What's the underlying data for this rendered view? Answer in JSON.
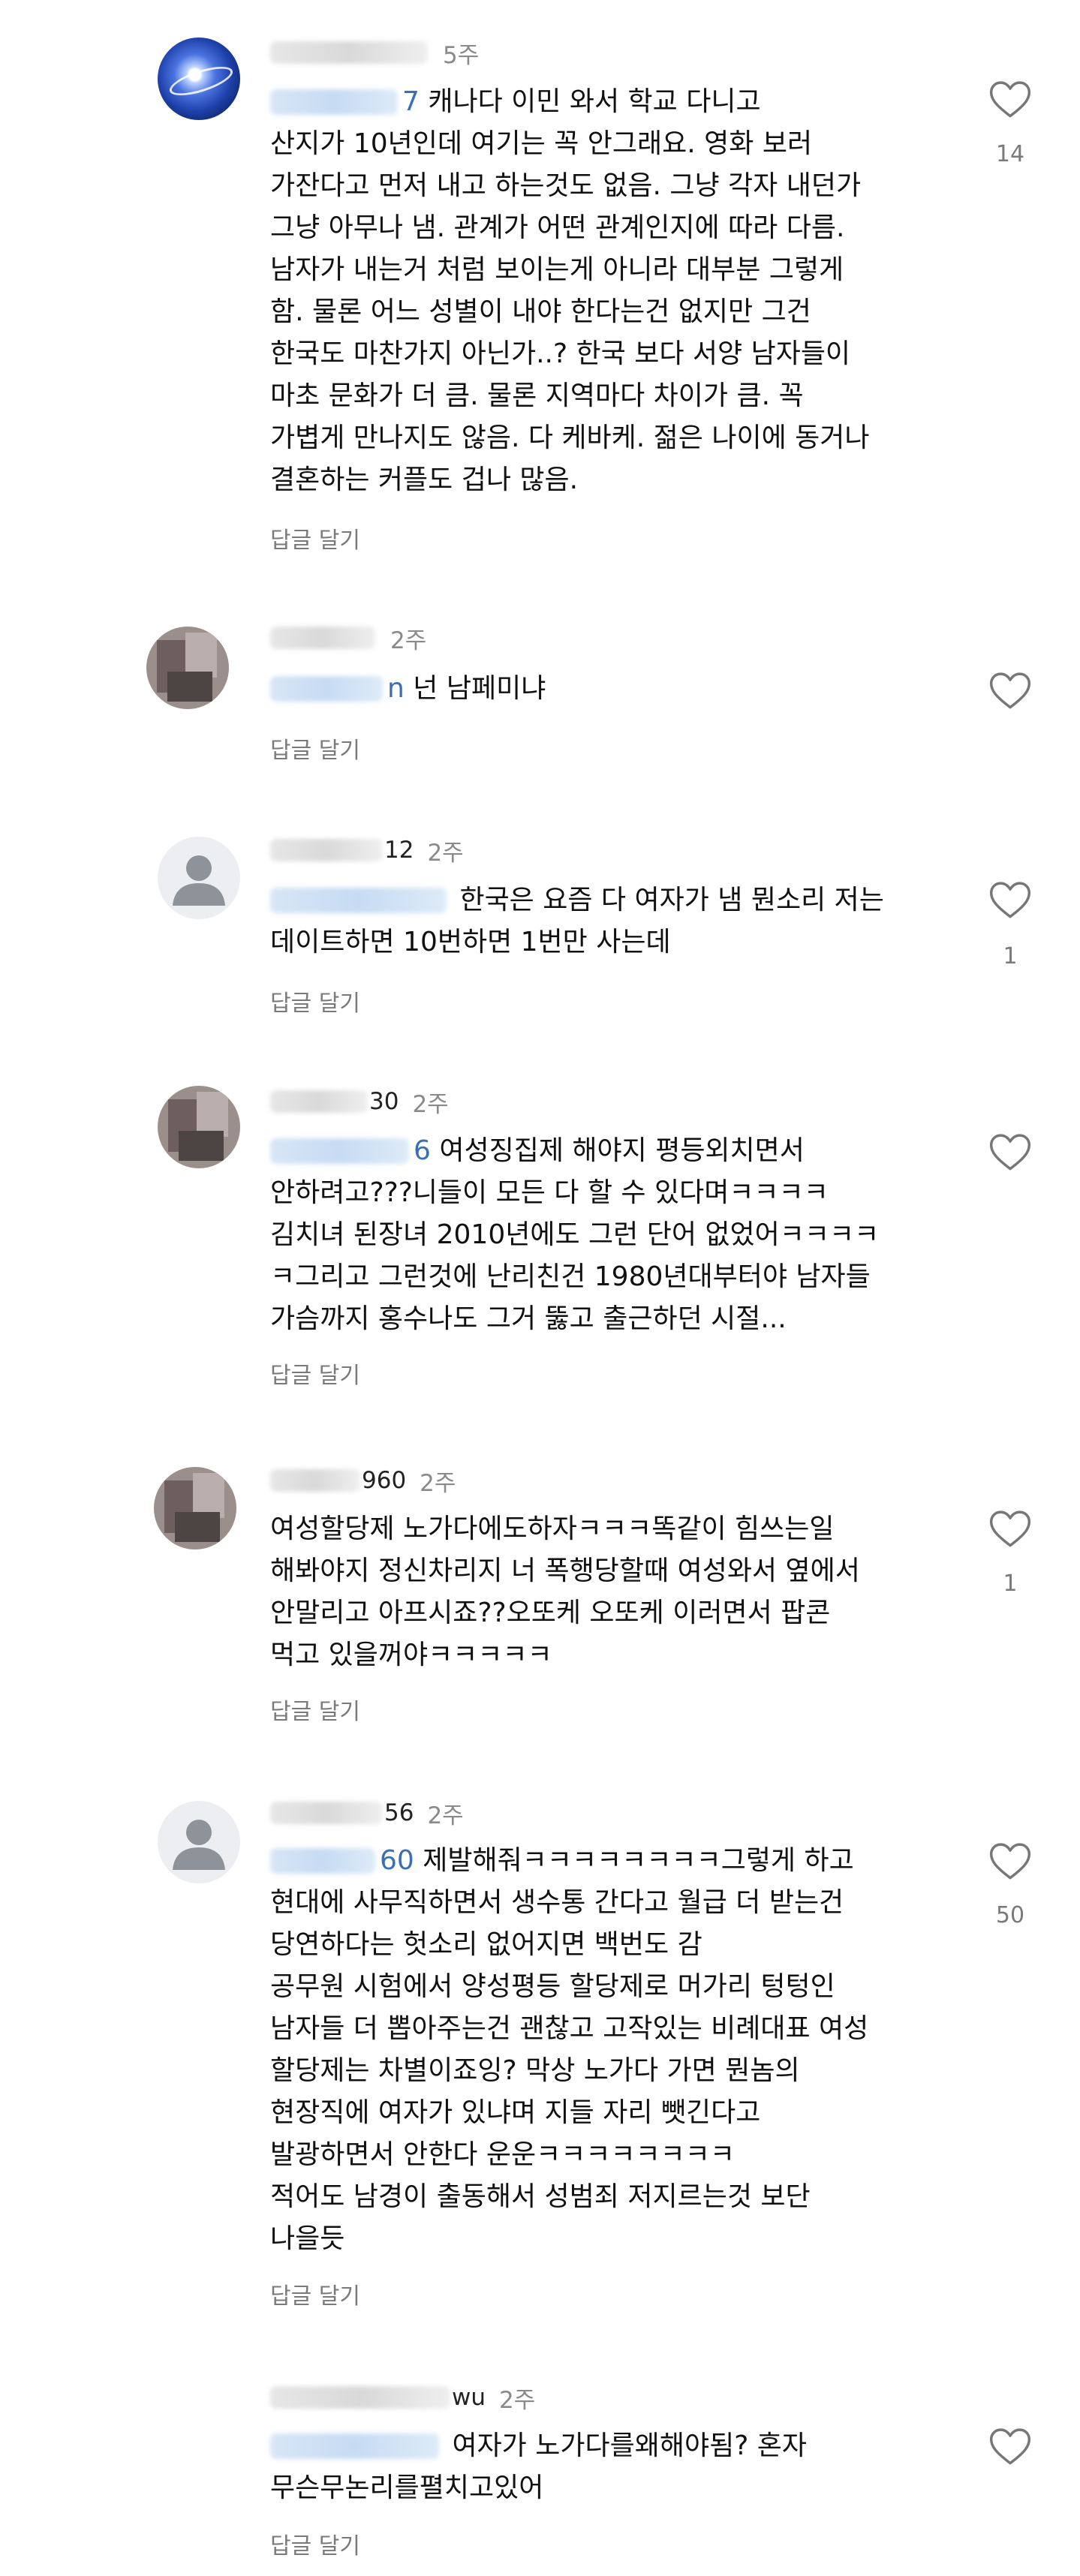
{
  "ui": {
    "reply_label": "답글 달기"
  },
  "comments": [
    {
      "name_tail": "",
      "time": "5주",
      "mention_tail": "7",
      "lines": [
        " 캐나다 이민 와서 학교 다니고",
        "산지가 10년인데 여기는 꼭 안그래요. 영화 보러",
        "가잔다고 먼저 내고 하는것도 없음. 그냥 각자 내던가",
        "그냥 아무나 냄. 관계가 어떤 관계인지에 따라 다름.",
        "남자가 내는거 처럼 보이는게 아니라 대부분 그렇게",
        "함. 물론 어느 성별이 내야 한다는건 없지만 그건",
        "한국도 마찬가지 아닌가..? 한국 보다 서양 남자들이",
        "마초 문화가 더 큼. 물론 지역마다 차이가 큼. 꼭",
        "가볍게 만나지도 않음. 다 케바케. 젊은 나이에 동거나",
        "결혼하는 커플도 겁나 많음."
      ],
      "likes": "14"
    },
    {
      "name_tail": "",
      "time": "2주",
      "mention_tail": "n",
      "lines": [
        " 넌 남페미냐"
      ],
      "likes": ""
    },
    {
      "name_tail": "12",
      "time": "2주",
      "mention_tail": "",
      "lines": [
        " 한국은 요즘 다 여자가 냄 뭔소리 저는",
        "데이트하면 10번하면 1번만 사는데"
      ],
      "likes": "1"
    },
    {
      "name_tail": "30",
      "time": "2주",
      "mention_tail": "6",
      "lines": [
        " 여성징집제 해야지 평등외치면서",
        "안하려고???니들이 모든 다 할 수 있다며ㅋㅋㅋㅋ",
        "김치녀 된장녀 2010년에도 그런 단어 없었어ㅋㅋㅋㅋ",
        "ㅋ그리고 그런것에 난리친건 1980년대부터야 남자들",
        "가슴까지 홍수나도 그거 뚫고 출근하던 시절..."
      ],
      "likes": ""
    },
    {
      "name_tail": "960",
      "time": "2주",
      "mention_tail": "",
      "lines": [
        "여성할당제 노가다에도하자ㅋㅋㅋ똑같이 힘쓰는일",
        "해봐야지 정신차리지 너 폭행당할때 여성와서 옆에서",
        "안말리고 아프시죠??오또케 오또케 이러면서 팝콘",
        "먹고 있을꺼야ㅋㅋㅋㅋㅋ"
      ],
      "likes": "1"
    },
    {
      "name_tail": "56",
      "time": "2주",
      "mention_tail": "60",
      "lines": [
        " 제발해줘ㅋㅋㅋㅋㅋㅋㅋㅋ그렇게 하고",
        "현대에 사무직하면서 생수통 간다고 월급 더 받는건",
        "당연하다는 헛소리 없어지면 백번도 감",
        "공무원 시험에서 양성평등 할당제로 머가리 텅텅인",
        "남자들 더 뽑아주는건 괜찮고 고작있는 비례대표 여성",
        "할당제는 차별이죠잉? 막상 노가다 가면 뭔놈의",
        "현장직에 여자가 있냐며 지들 자리 뺏긴다고",
        "발광하면서 안한다 운운ㅋㅋㅋㅋㅋㅋㅋㅋ",
        "적어도 남경이 출동해서 성범죄 저지르는것 보단",
        "나을듯"
      ],
      "likes": "50"
    },
    {
      "name_tail": "wu",
      "time": "2주",
      "mention_tail": "",
      "lines": [
        " 여자가 노가다를왜해야됨? 혼자",
        "무슨무논리를펼치고있어"
      ],
      "likes": ""
    }
  ]
}
